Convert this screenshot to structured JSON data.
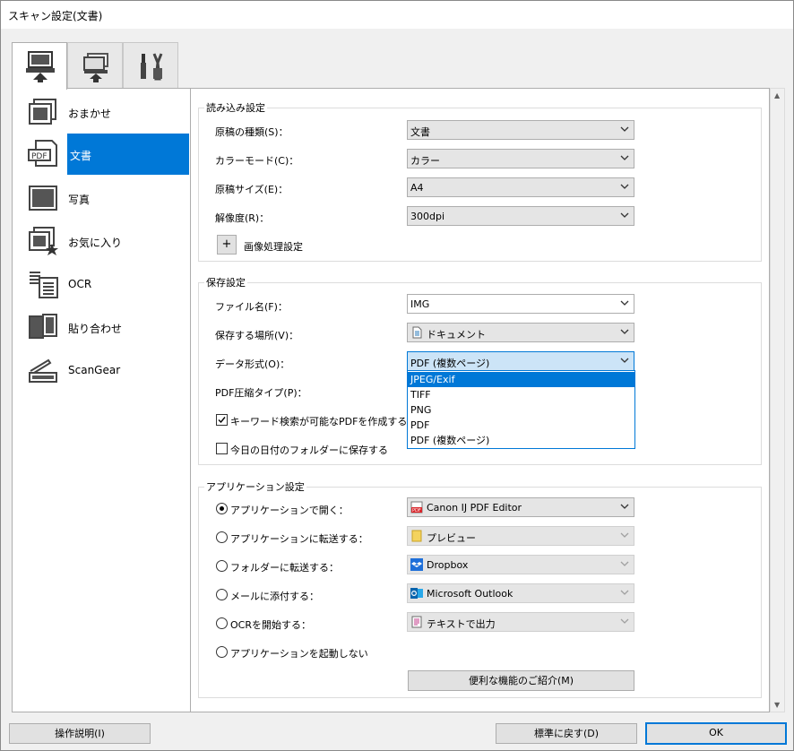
{
  "window": {
    "title": "スキャン設定(文書)"
  },
  "tabs": [
    {
      "icon": "scan-from-computer-icon"
    },
    {
      "icon": "scan-from-operation-panel-icon"
    },
    {
      "icon": "tools-icon"
    }
  ],
  "sidebar": {
    "items": [
      {
        "label": "おまかせ",
        "icon": "auto-scan-icon"
      },
      {
        "label": "文書",
        "icon": "pdf-document-icon"
      },
      {
        "label": "写真",
        "icon": "photo-icon"
      },
      {
        "label": "お気に入り",
        "icon": "favorite-icon"
      },
      {
        "label": "OCR",
        "icon": "ocr-icon"
      },
      {
        "label": "貼り合わせ",
        "icon": "stitch-icon"
      },
      {
        "label": "ScanGear",
        "icon": "scangear-icon"
      }
    ]
  },
  "read_settings": {
    "legend": "読み込み設定",
    "doc_type": {
      "label": "原稿の種類(S)：",
      "value": "文書"
    },
    "color_mode": {
      "label": "カラーモード(C)：",
      "value": "カラー"
    },
    "size": {
      "label": "原稿サイズ(E)：",
      "value": "A4"
    },
    "resolution": {
      "label": "解像度(R)：",
      "value": "300dpi"
    },
    "image_processing": {
      "plus": "+",
      "label": "画像処理設定"
    }
  },
  "save_settings": {
    "legend": "保存設定",
    "filename": {
      "label": "ファイル名(F)：",
      "value": "IMG"
    },
    "location": {
      "label": "保存する場所(V)：",
      "value": "ドキュメント"
    },
    "data_format": {
      "label": "データ形式(O)：",
      "value": "PDF (複数ページ)",
      "options": [
        "JPEG/Exif",
        "TIFF",
        "PNG",
        "PDF",
        "PDF (複数ページ)"
      ],
      "highlighted": "JPEG/Exif"
    },
    "pdf_compression": {
      "label": "PDF圧縮タイプ(P)："
    },
    "keyword_search": {
      "label": "キーワード検索が可能なPDFを作成する(A)",
      "checked": true
    },
    "date_folder": {
      "label": "今日の日付のフォルダーに保存する",
      "checked": false
    }
  },
  "app_settings": {
    "legend": "アプリケーション設定",
    "options": [
      {
        "label": "アプリケーションで開く：",
        "selected": true,
        "app": "Canon IJ PDF Editor",
        "icon": "pdf-editor-icon",
        "enabled": true
      },
      {
        "label": "アプリケーションに転送する：",
        "selected": false,
        "app": "プレビュー",
        "icon": "folder-icon",
        "enabled": false
      },
      {
        "label": "フォルダーに転送する：",
        "selected": false,
        "app": "Dropbox",
        "icon": "dropbox-icon",
        "enabled": false
      },
      {
        "label": "メールに添付する：",
        "selected": false,
        "app": "Microsoft Outlook",
        "icon": "outlook-icon",
        "enabled": false
      },
      {
        "label": "OCRを開始する：",
        "selected": false,
        "app": "テキストで出力",
        "icon": "text-output-icon",
        "enabled": false
      },
      {
        "label": "アプリケーションを起動しない",
        "selected": false
      }
    ],
    "features_button": "便利な機能のご紹介(M)"
  },
  "footer": {
    "instructions": "操作説明(I)",
    "defaults": "標準に戻す(D)",
    "ok": "OK"
  },
  "colors": {
    "accent": "#0078d7",
    "selection": "#0078d7"
  }
}
